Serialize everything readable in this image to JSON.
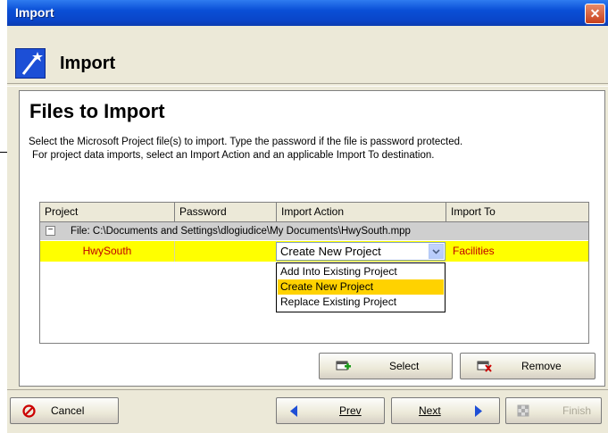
{
  "window": {
    "title": "Import",
    "close_glyph": "✕"
  },
  "header": {
    "title": "Import",
    "icon": "wand-icon"
  },
  "section": {
    "title": "Files to Import",
    "description_line1": "Select the Microsoft Project file(s) to import.  Type the password if the file is password protected.",
    "description_line2": "For project data imports, select an Import Action and an applicable Import To destination."
  },
  "grid": {
    "columns": [
      "Project",
      "Password",
      "Import Action",
      "Import To"
    ],
    "group": {
      "expander": "−",
      "label": "File: C:\\Documents and Settings\\dlogiudice\\My Documents\\HwySouth.mpp"
    },
    "row": {
      "project": "HwySouth",
      "password": "",
      "import_action": "Create New Project",
      "import_to": "Facilities"
    },
    "dropdown_options": [
      "Add Into Existing Project",
      "Create New Project",
      "Replace Existing Project"
    ],
    "dropdown_selected_index": 1
  },
  "buttons": {
    "select": "Select",
    "remove": "Remove",
    "cancel": "Cancel",
    "prev": "Prev",
    "next": "Next",
    "finish": "Finish"
  },
  "colors": {
    "highlight_row": "#ffff00",
    "selected_option": "#ffd200",
    "title_bar": "#0a4fd6"
  }
}
